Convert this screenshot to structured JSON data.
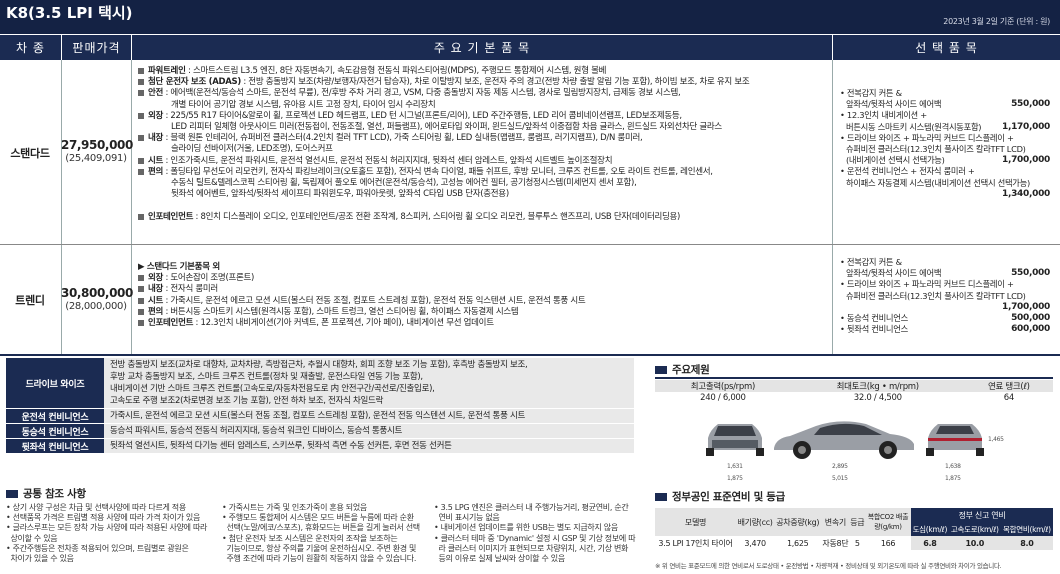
{
  "title": "K8(3.5 LPI 택시)",
  "date": "2023년 3월 2일 기준 (단위 : 원)",
  "headers": {
    "trim": "차 종",
    "price": "판매가격",
    "features": "주 요 기 본 품 목",
    "options": "선 택 품 목"
  },
  "standard": {
    "name": "스탠다드",
    "price": "27,950,000",
    "price_sub": "(25,409,091)",
    "lines": [
      {
        "b": "파워트레인",
        "t": " : 스마트스트림 L3.5 엔진, 8단 자동변속기, 속도감응형 전동식 파워스티어링(MDPS), 주행모드 통합제어 시스템, 원형 볼베"
      },
      {
        "b": "첨단 운전자 보조 (ADAS)",
        "t": " : 전방 충돌방지 보조(차량/보행자/자전거 탑승자), 차로 이탈방지 보조, 운전자 주의 경고(전방 차량 출발 알림 기능 포함), 하이빔 보조, 차로 유지 보조"
      },
      {
        "b": "안전",
        "t": " : 에어백(운전석/동승석 스마트, 운전석 무릎), 전/후방 주차 거리 경고, VSM, 다중 충돌방지 자동 제동 시스템, 경사로 밀림방지장치, 급제동 경보 시스템,"
      },
      {
        "i": "개별 타이어 공기압 경보 시스템, 유아용 시트 고정 장치, 타이어 임시 수리장치"
      },
      {
        "b": "외장",
        "t": " : 225/55 R17 타이어&알로이 휠, 프로젝션 LED 헤드램프, LED 턴 시그널(프론트/리어), LED 주간주행등, LED 리어 콤비네이션램프, LED보조제동등,"
      },
      {
        "i": "LED 리피터 일체형 아웃사이드 미러(전동접이, 전동조절, 열선, 퍼들램프), 에어로타입 와이퍼, 윈드실드/앞좌석 이중접합 차음 글라스, 윈드실드 자외선차단 글라스"
      },
      {
        "b": "내장",
        "t": " : 블랙 원톤 인테리어, 슈퍼비전 클러스터(4.2인치 컬러 TFT LCD), 가죽 스티어링 휠, LED 실내등(맵램프, 룸램프, 러기지램프), D/N 룸미러,"
      },
      {
        "i": "슬라이딩 선바이저(거울, LED조명), 도어스커프"
      },
      {
        "b": "시트",
        "t": " : 인조가죽시트, 운전석 파워시트, 운전석 열선시트, 운전석 전동식 허리지지대, 뒷좌석 센터 암레스트, 앞좌석 시트벨트 높이조절장치"
      },
      {
        "b": "편의",
        "t": " : 폴딩타입 무선도어 리모컨키, 전자식 파킹브레이크(오토홀드 포함), 전자식 변속 다이얼, 패들 쉬프트, 후방 모니터, 크루즈 컨트롤, 오토 라이트 컨트롤, 레인센서,"
      },
      {
        "i": "수동식 틸트&텔레스코픽 스티어링 휠, 독립제어 풀오토 에어컨(운전석/동승석), 고성능 에어컨 필터, 공기청정시스템(미세먼지 센서 포함),"
      },
      {
        "i": "뒷좌석 에어벤트, 앞좌석/뒷좌석 세이프티 파워윈도우, 파워아웃렛, 앞좌석 C타입 USB 단자(충전용)"
      },
      {
        "gap": true
      },
      {
        "b": "인포테인먼트",
        "t": " : 8인치 디스플레이 오디오, 인포테인먼트/공조 전환 조작계, 8스피커, 스티어링 휠 오디오 리모컨, 블루투스 핸즈프리, USB 단자(데이터리딩용)"
      }
    ],
    "options": [
      {
        "name": "전복감지 커튼 &",
        "price": ""
      },
      {
        "name": "앞좌석/뒷좌석 사이드 에어백",
        "price": "550,000"
      },
      {
        "name": "12.3인치 내비게이션 +",
        "price": ""
      },
      {
        "name": "버튼시동 스마트키 시스템(원격시동포함)",
        "price": "1,170,000"
      },
      {
        "name": "드라이브 와이즈 + 파노라믹 커브드 디스플레이 +",
        "price": ""
      },
      {
        "name": "슈퍼비전 클러스터(12.3인치 풀사이즈 칼라TFT LCD)",
        "price": ""
      },
      {
        "name": "(내비게이션 선택시 선택가능)",
        "price": "1,700,000"
      },
      {
        "name": "운전석 컨비니언스 + 전자식 룸미러 +",
        "price": ""
      },
      {
        "name": "하이패스 자동결제 시스템(내비게이션 선택시 선택가능)",
        "price": ""
      },
      {
        "name": "",
        "price": "1,340,000"
      }
    ]
  },
  "trendy": {
    "name": "트렌디",
    "price": "30,800,000",
    "price_sub": "(28,000,000)",
    "lines": [
      {
        "arrow": "▶ 스탠다드 기본품목 외"
      },
      {
        "b": "외장",
        "t": " : 도어손잡이 조명(프론트)"
      },
      {
        "b": "내장",
        "t": " : 전자식 룸미러"
      },
      {
        "b": "시트",
        "t": " : 가죽시트, 운전석 에르고 모션 시트(볼스터 전동 조절, 컴포트 스트레칭 포함), 운전석 전동 익스텐션 시트, 운전석 통풍 시트"
      },
      {
        "b": "편의",
        "t": " : 버튼시동 스마트키 시스템(원격시동 포함), 스마트 트렁크, 열선 스티어링 휠, 하이패스 자동결제 시스템"
      },
      {
        "b": "인포테인먼트",
        "t": " : 12.3인치 내비게이션(기아 커넥트, 폰 프로젝션, 기아 페이), 내비게이션 무선 업데이트"
      }
    ],
    "options": [
      {
        "name": "전복감지 커튼 &",
        "price": ""
      },
      {
        "name": "앞좌석/뒷좌석 사이드 에어백",
        "price": "550,000"
      },
      {
        "name": "드라이브 와이즈 + 파노라믹 커브드 디스플레이 +",
        "price": ""
      },
      {
        "name": "슈퍼비전 클러스터(12.3인치 풀사이즈 칼라TFT LCD)",
        "price": ""
      },
      {
        "name": "",
        "price": "1,700,000"
      },
      {
        "name": "동승석 컨비니언스",
        "price": "500,000"
      },
      {
        "name": "뒷좌석 컨비니언스",
        "price": "600,000"
      }
    ]
  },
  "option_packages": [
    {
      "label": "드라이브 와이즈",
      "text": [
        "전방 충돌방지 보조(교차로 대향차, 교차차량, 측방접근차, 추월시 대향차, 회피 조향 보조 기능 포함), 후측방 충돌방지 보조,",
        "후방 교차 충돌방지 보조, 스마트 크루즈 컨트롤(정차 및 재출발, 운전스타일 연동 기능 포함),",
        "내비게이션 기반 스마트 크루즈 컨트롤(고속도로/자동차전용도로 内 안전구간/곡선로/진출입로),",
        "고속도로 주행 보조2(차로변경 보조 기능 포함), 안전 하차 보조, 전자식 차일드락"
      ]
    },
    {
      "label": "운전석 컨비니언스",
      "text": [
        "가죽시트, 운전석 에르고 모션 시트(볼스터 전동 조절, 컴포트 스트레칭 포함), 운전석 전동 익스텐션 시트, 운전석 통풍 시트"
      ]
    },
    {
      "label": "동승석 컨비니언스",
      "text": [
        "동승석 파워시트, 동승석 전동식 허리지지대, 동승석 워크인 디바이스, 동승석 통풍시트"
      ]
    },
    {
      "label": "뒷좌석 컨비니언스",
      "text": [
        "뒷좌석 열선시트, 뒷좌석 다기능 센터 암레스트, 스키쓰루, 뒷좌석 측면 수동 선커튼, 후면 전동 선커튼"
      ]
    }
  ],
  "common": {
    "title": "공통 참조 사항",
    "col1": [
      "• 상기 사양 구성은 차급 및 선택사양에 따라 다르게 적용",
      "• 선택품목 가격은 트림별 적용 사양에 따라 가격 차이가 있음",
      "• 글라스루프는 모든 장착 가능 사양에 따라 적용된 사양에 따라",
      "  상이할 수 있음",
      "• 주간주행등은 전차종 적용되어 있으며, 트림별로 광원은",
      "  차이가 있을 수 있음"
    ],
    "col2": [
      "• 가죽시트는 가죽 및 인조가죽이 혼용 되었음",
      "• 주행모드 통합제어 시스템은 모드 버튼을 누름에 따라 순환",
      "  선택(노말/에코/스포츠), 휴화모드는 버튼을 길게 눌러서 선택",
      "• 첨단 운전자 보조 시스템은 운전자의 조작을 보조하는",
      "  기능이므로, 항상 주의를 기울여 운전하십시오. 주변 환경 및",
      "  주행 조건에 따라 기능이 원활히 작동하지 않을 수 있습니다."
    ],
    "col3": [
      "• 3.5 LPG 엔진은 클러스터 내 주행가능거리, 평균연비, 순간",
      "  연비 표시기능 없음",
      "• 내비게이션 업데이트를 위한 USB는 별도 지급하지 않음",
      "• 클러스터 테마 중 'Dynamic' 설정 시 GSP 및 기상 정보에 따",
      "  라 클러스터 이미지가 표현되므로 차량위치, 시간, 기상 변화",
      "  등의 이유로 실제 날씨와 상이할 수 있음"
    ]
  },
  "specs": {
    "title": "주요제원",
    "headers": [
      "최고출력(ps/rpm)",
      "최대토크(kg • m/rpm)",
      "연료 탱크(ℓ)"
    ],
    "values": [
      "240 / 6,000",
      "32.0 / 4,500",
      "64"
    ],
    "dims": {
      "front_w": "1,631",
      "front_t": "1,875",
      "side_wb": "2,895",
      "side_l": "5,015",
      "side_h": "1,465",
      "rear_w": "1,638",
      "rear_t": "1,875"
    }
  },
  "efficiency": {
    "title": "정부공인 표준연비 및 등급",
    "h1": [
      "모델명",
      "배기량(cc)",
      "공차중량(kg)",
      "변속기",
      "등급",
      "복합CO2 배출량(g/km)",
      "정부 신고 연비"
    ],
    "h2": [
      "도심(km/ℓ)",
      "고속도로(km/ℓ)",
      "복합연비(km/ℓ)"
    ],
    "row": [
      "3.5 LPI 17인치 타이어",
      "3,470",
      "1,625",
      "자동8단",
      "5",
      "166",
      "6.8",
      "10.0",
      "8.0"
    ],
    "note": "※ 위 연비는 표준모드에 의한 연비로서 도로상태 • 운전방법 • 차량적재 • 정비상태 및 외기온도에 따라 실 주행연비와 차이가 있습니다."
  },
  "colors": {
    "navy": "#1b2b52",
    "dark": "#142244"
  }
}
